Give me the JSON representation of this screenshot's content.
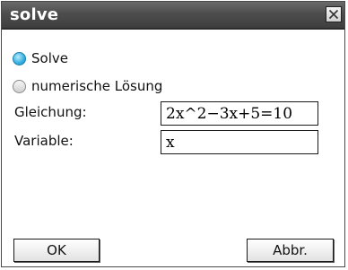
{
  "dialog": {
    "title": "solve",
    "close_icon": "close-icon"
  },
  "options": {
    "solve_label": "Solve",
    "solve_selected": true,
    "numeric_label": "numerische Lösung",
    "numeric_selected": false
  },
  "fields": {
    "equation_label": "Gleichung:",
    "equation_value": "2x^2−3x+5=10",
    "variable_label": "Variable:",
    "variable_value": "x"
  },
  "buttons": {
    "ok_label": "OK",
    "cancel_label": "Abbr."
  },
  "colors": {
    "titlebar": "#4d4d4d",
    "radio_selected": "#33aee0"
  }
}
